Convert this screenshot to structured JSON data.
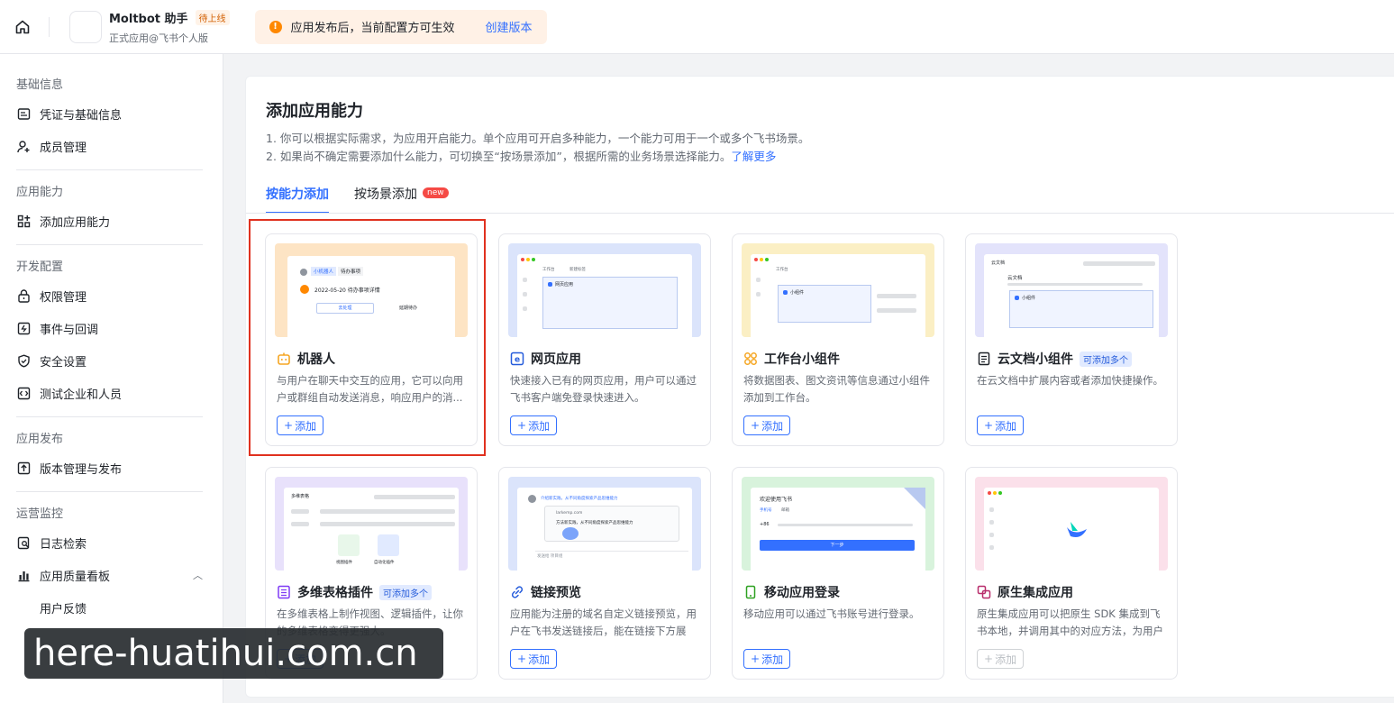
{
  "header": {
    "app_name": "Moltbot 助手",
    "status": "待上线",
    "app_type": "正式应用@飞书个人版",
    "notice_text": "应用发布后，当前配置方可生效",
    "notice_link": "创建版本"
  },
  "sidebar": {
    "sections": [
      {
        "title": "基础信息",
        "items": [
          {
            "label": "凭证与基础信息",
            "icon": "credential-icon"
          },
          {
            "label": "成员管理",
            "icon": "member-add-icon"
          }
        ]
      },
      {
        "title": "应用能力",
        "items": [
          {
            "label": "添加应用能力",
            "icon": "apps-add-icon"
          }
        ]
      },
      {
        "title": "开发配置",
        "items": [
          {
            "label": "权限管理",
            "icon": "lock-icon"
          },
          {
            "label": "事件与回调",
            "icon": "event-icon"
          },
          {
            "label": "安全设置",
            "icon": "shield-icon"
          },
          {
            "label": "测试企业和人员",
            "icon": "test-icon"
          }
        ]
      },
      {
        "title": "应用发布",
        "items": [
          {
            "label": "版本管理与发布",
            "icon": "upload-icon"
          }
        ]
      },
      {
        "title": "运营监控",
        "items": [
          {
            "label": "日志检索",
            "icon": "log-search-icon"
          },
          {
            "label": "应用质量看板",
            "icon": "chart-icon"
          },
          {
            "label": "用户反馈",
            "icon": ""
          }
        ]
      }
    ]
  },
  "main": {
    "title": "添加应用能力",
    "desc1": "1. 你可以根据实际需求，为应用开启能力。单个应用可开启多种能力，一个能力可用于一个或多个飞书场景。",
    "desc2": "2. 如果尚不确定需要添加什么能力，可切换至“按场景添加”，根据所需的业务场景选择能力。",
    "learn_more": "了解更多",
    "tabs": [
      {
        "label": "按能力添加",
        "active": true
      },
      {
        "label": "按场景添加",
        "badge": "new"
      }
    ]
  },
  "thumbs": {
    "bot_tag1": "小机器人",
    "bot_tag2": "待办事项",
    "bot_line": "2022-05-20 待办事项详情",
    "bot_btn1": "去处理",
    "bot_btn2": "延期待办",
    "web_tab1": "工作台",
    "web_tab2": "新建标签",
    "web_label": "网页应用",
    "widget_tab": "工作台",
    "widget_label": "小组件",
    "doc_top": "云文档",
    "doc_title": "云文档",
    "doc_label": "小组件",
    "bitable_title": "多维表格",
    "bitable_view": "视图插件",
    "bitable_logic": "自动化插件",
    "link_header": "介绍新实践，从不同角度探索产品思维能力",
    "link_host": "larkemp.com",
    "link_line": "方法新实践，从不同角度探索产品思维能力",
    "link_input": "发送给 项目组",
    "mobile_title": "欢迎使用飞书",
    "mobile_tab1": "手机号",
    "mobile_tab2": "邮箱",
    "mobile_code": "+86",
    "mobile_btn": "下一步"
  },
  "cards": [
    {
      "title": "机器人",
      "icon": "robot-icon",
      "desc": "与用户在聊天中交互的应用，它可以向用户或群组自动发送消息，响应用户的消...",
      "button": "添加",
      "badge": "",
      "disabled": false,
      "theme": "#fde4c4"
    },
    {
      "title": "网页应用",
      "icon": "web-app-icon",
      "desc": "快速接入已有的网页应用，用户可以通过飞书客户端免登录快速进入。",
      "button": "添加",
      "badge": "",
      "disabled": false,
      "theme": "#dbe4fb"
    },
    {
      "title": "工作台小组件",
      "icon": "widget-icon",
      "desc": "将数据图表、图文资讯等信息通过小组件添加到工作台。",
      "button": "添加",
      "badge": "",
      "disabled": false,
      "theme": "#fbefc4"
    },
    {
      "title": "云文档小组件",
      "icon": "doc-widget-icon",
      "desc": "在云文档中扩展内容或者添加快捷操作。",
      "button": "添加",
      "badge": "可添加多个",
      "disabled": false,
      "theme": "#e3e3fb"
    },
    {
      "title": "多维表格插件",
      "icon": "bitable-icon",
      "desc": "在多维表格上制作视图、逻辑插件，让你的多维表格变得更强大。",
      "button": "添加",
      "badge": "可添加多个",
      "disabled": false,
      "theme": "#e8e1fb"
    },
    {
      "title": "链接预览",
      "icon": "link-icon",
      "desc": "应用能为注册的域名自定义链接预览，用户在飞书发送链接后，能在链接下方展示...",
      "button": "添加",
      "badge": "",
      "disabled": false,
      "theme": "#dbe4fb"
    },
    {
      "title": "移动应用登录",
      "icon": "mobile-icon",
      "desc": "移动应用可以通过飞书账号进行登录。",
      "button": "添加",
      "badge": "",
      "disabled": false,
      "theme": "#d8f3dc"
    },
    {
      "title": "原生集成应用",
      "icon": "native-app-icon",
      "desc": "原生集成应用可以把原生 SDK 集成到飞书本地，并调用其中的对应方法，为用户提...",
      "button": "添加",
      "badge": "",
      "disabled": true,
      "theme": "#fbe0ea"
    }
  ],
  "watermark": "here-huatihui.com.cn"
}
